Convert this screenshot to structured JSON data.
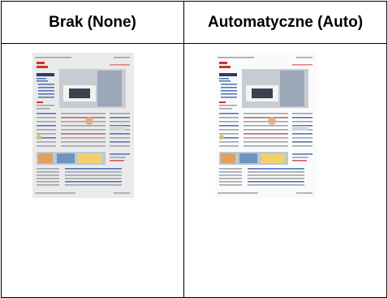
{
  "table": {
    "columns": [
      {
        "id": "none",
        "header": "Brak (None)"
      },
      {
        "id": "auto",
        "header": "Automatyczne (Auto)"
      }
    ]
  },
  "sample_doc": {
    "brand_color": "#d32f2f",
    "link_color": "#4a6fb5",
    "page_bg_none": "#eaeaea",
    "page_bg_auto": "#fafafa"
  }
}
